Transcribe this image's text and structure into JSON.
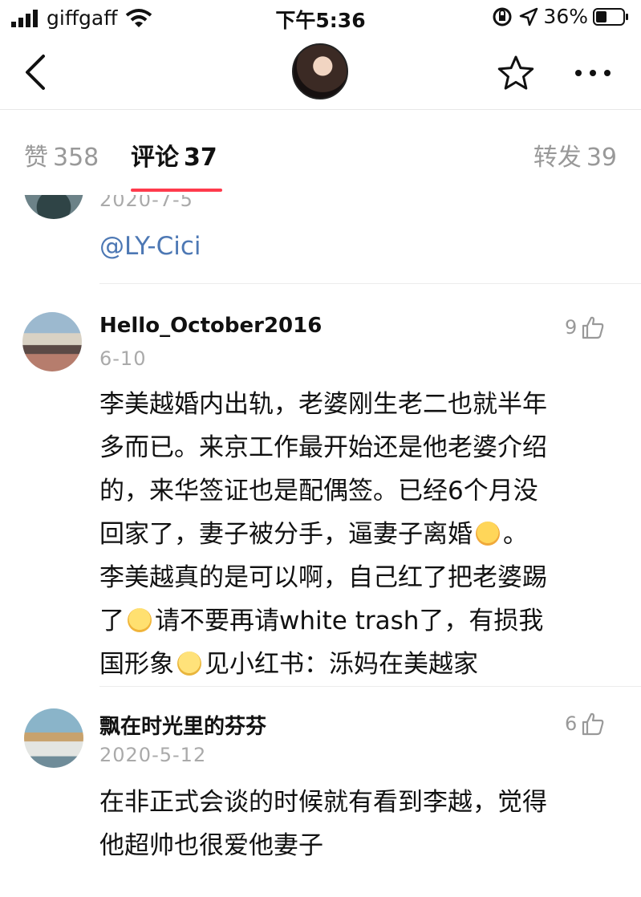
{
  "status_bar": {
    "carrier": "giffgaff",
    "time": "下午5:36",
    "battery": "36%"
  },
  "tabs": {
    "likes_label": "赞",
    "likes_count": "358",
    "comments_label": "评论",
    "comments_count": "37",
    "reposts_label": "转发",
    "reposts_count": "39"
  },
  "comments": [
    {
      "date": "2020-7-5",
      "mention": "@LY-Cici"
    },
    {
      "username": "Hello_October2016",
      "date": "6-10",
      "likes": "9",
      "lines": [
        "李美越婚内出轨，老婆刚生老二也就半年",
        "多而已。来京工作最开始还是他老婆介绍",
        "的，来华签证也是配偶签。已经6个月没",
        "回家了，妻子被分手，逼妻子离婚",
        "。",
        "李美越真的是可以啊，自己红了把老婆踢",
        "了",
        "请不要再请white trash了，有损我",
        "国形象",
        "见小红书：泺妈在美越家"
      ]
    },
    {
      "username": "飘在时光里的芬芬",
      "date": "2020-5-12",
      "likes": "6",
      "lines": [
        "在非正式会谈的时候就有看到李越，觉得",
        "他超帅也很爱他妻子"
      ]
    }
  ],
  "colors": {
    "accent": "#ff3b4d",
    "link": "#4d78b4",
    "muted": "#999999"
  },
  "icons": [
    "signal-icon",
    "wifi-icon",
    "lock-rotation-icon",
    "location-icon",
    "battery-icon",
    "back-icon",
    "star-icon",
    "more-icon",
    "thumbs-up-icon"
  ]
}
